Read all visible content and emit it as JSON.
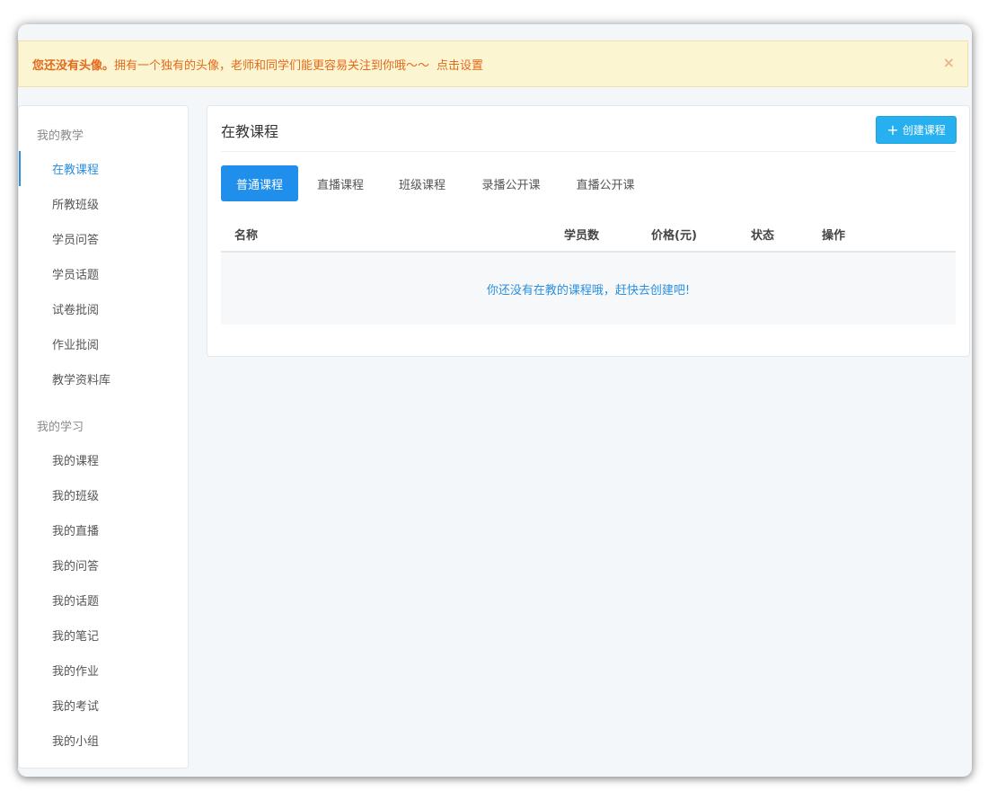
{
  "alert": {
    "strong_text": "您还没有头像。",
    "message": "拥有一个独有的头像，老师和同学们能更容易关注到你哦～～",
    "link_label": "点击设置",
    "close_label": "×"
  },
  "sidebar": {
    "teaching": {
      "title": "我的教学",
      "items": [
        {
          "label": "在教课程"
        },
        {
          "label": "所教班级"
        },
        {
          "label": "学员问答"
        },
        {
          "label": "学员话题"
        },
        {
          "label": "试卷批阅"
        },
        {
          "label": "作业批阅"
        },
        {
          "label": "教学资料库"
        }
      ]
    },
    "learning": {
      "title": "我的学习",
      "items": [
        {
          "label": "我的课程"
        },
        {
          "label": "我的班级"
        },
        {
          "label": "我的直播"
        },
        {
          "label": "我的问答"
        },
        {
          "label": "我的话题"
        },
        {
          "label": "我的笔记"
        },
        {
          "label": "我的作业"
        },
        {
          "label": "我的考试"
        },
        {
          "label": "我的小组"
        }
      ]
    }
  },
  "main": {
    "title": "在教课程",
    "create_button": {
      "icon": "plus-icon",
      "glyph": "+",
      "label": "创建课程"
    },
    "tabs": [
      {
        "label": "普通课程"
      },
      {
        "label": "直播课程"
      },
      {
        "label": "班级课程"
      },
      {
        "label": "录播公开课"
      },
      {
        "label": "直播公开课"
      }
    ],
    "table": {
      "columns": [
        "名称",
        "学员数",
        "价格(元)",
        "状态",
        "操作"
      ],
      "empty_message": "你还没有在教的课程哦，赶快去创建吧!"
    }
  },
  "colors": {
    "accent": "#1f8feb",
    "button": "#26b0ef",
    "alert_text": "#e36a1c",
    "alert_bg": "#fcf5d1"
  }
}
